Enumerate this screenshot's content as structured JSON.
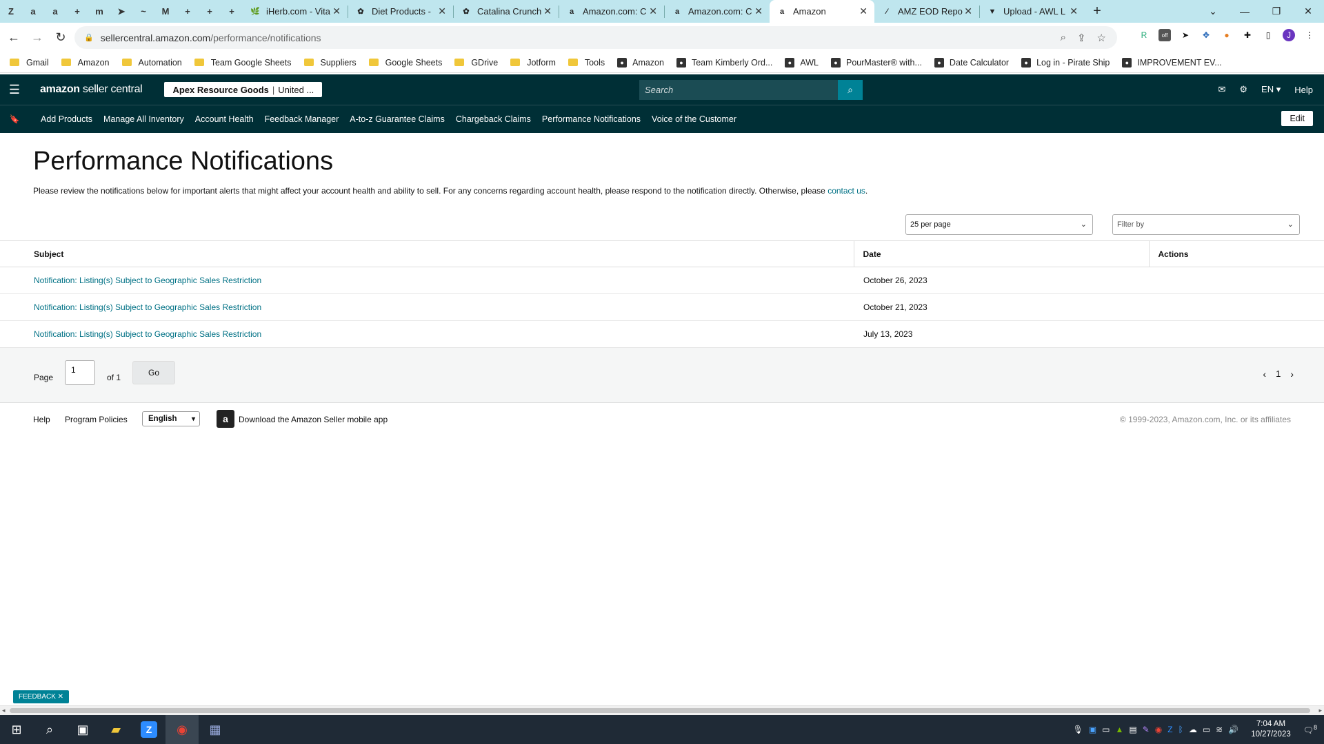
{
  "browser": {
    "pinned_tabs": [
      "Z",
      "a",
      "a",
      "+",
      "m",
      "➤",
      "~",
      "M",
      "+",
      "+",
      "+"
    ],
    "tabs": [
      {
        "title": "iHerb.com - Vita",
        "icon": "🌿",
        "active": false
      },
      {
        "title": "Diet Products -",
        "icon": "✿",
        "active": false
      },
      {
        "title": "Catalina Crunch",
        "icon": "✿",
        "active": false
      },
      {
        "title": "Amazon.com: C",
        "icon": "a",
        "active": false
      },
      {
        "title": "Amazon.com: C",
        "icon": "a",
        "active": false
      },
      {
        "title": "Amazon",
        "icon": "a",
        "active": true
      },
      {
        "title": "AMZ EOD Repo",
        "icon": "⁄",
        "active": false
      },
      {
        "title": "Upload - AWL L",
        "icon": "▼",
        "active": false
      }
    ],
    "url_host": "sellercentral.amazon.com",
    "url_path": "/performance/notifications",
    "bookmarks": [
      {
        "label": "Gmail",
        "type": "folder"
      },
      {
        "label": "Amazon",
        "type": "folder"
      },
      {
        "label": "Automation",
        "type": "folder"
      },
      {
        "label": "Team Google Sheets",
        "type": "folder"
      },
      {
        "label": "Suppliers",
        "type": "folder"
      },
      {
        "label": "Google Sheets",
        "type": "folder"
      },
      {
        "label": "GDrive",
        "type": "folder"
      },
      {
        "label": "Jotform",
        "type": "folder"
      },
      {
        "label": "Tools",
        "type": "folder"
      },
      {
        "label": "Amazon",
        "type": "site"
      },
      {
        "label": "Team Kimberly Ord...",
        "type": "site"
      },
      {
        "label": "AWL",
        "type": "site"
      },
      {
        "label": "PourMaster® with...",
        "type": "site"
      },
      {
        "label": "Date Calculator",
        "type": "site"
      },
      {
        "label": "Log in - Pirate Ship",
        "type": "site"
      },
      {
        "label": "IMPROVEMENT EV...",
        "type": "site"
      }
    ]
  },
  "header": {
    "logo_brand": "amazon",
    "logo_product": " seller central",
    "account_name": "Apex Resource Goods",
    "account_sep": "|",
    "account_region": "United ...",
    "search_placeholder": "Search",
    "language": "EN ▾",
    "help": "Help"
  },
  "nav": {
    "links": [
      "Add Products",
      "Manage All Inventory",
      "Account Health",
      "Feedback Manager",
      "A-to-z Guarantee Claims",
      "Chargeback Claims",
      "Performance Notifications",
      "Voice of the Customer"
    ],
    "edit": "Edit"
  },
  "page": {
    "title": "Performance Notifications",
    "description": "Please review the notifications below for important alerts that might affect your account health and ability to sell. For any concerns regarding account health, please respond to the notification directly. Otherwise, please ",
    "contact_link": "contact us",
    "description_end": "."
  },
  "filters": {
    "per_page": "25 per page",
    "filter_placeholder": "Filter by"
  },
  "table": {
    "headers": {
      "subject": "Subject",
      "date": "Date",
      "actions": "Actions"
    },
    "rows": [
      {
        "subject": "Notification: Listing(s) Subject to Geographic Sales Restriction",
        "date": "October 26, 2023"
      },
      {
        "subject": "Notification: Listing(s) Subject to Geographic Sales Restriction",
        "date": "October 21, 2023"
      },
      {
        "subject": "Notification: Listing(s) Subject to Geographic Sales Restriction",
        "date": "July 13, 2023"
      }
    ]
  },
  "pagination": {
    "page_label": "Page",
    "page_value": "1",
    "of_label": "of 1",
    "go": "Go",
    "current": "1"
  },
  "footer": {
    "help": "Help",
    "policies": "Program Policies",
    "language": "English",
    "app_text": "Download the Amazon Seller mobile app",
    "copyright": "© 1999-2023, Amazon.com, Inc. or its affiliates"
  },
  "feedback": "FEEDBACK ✕",
  "taskbar": {
    "time": "7:04 AM",
    "date": "10/27/2023",
    "notifications": "8"
  },
  "colors": {
    "header_bg": "#002f36",
    "link": "#007185",
    "accent": "#008296"
  }
}
